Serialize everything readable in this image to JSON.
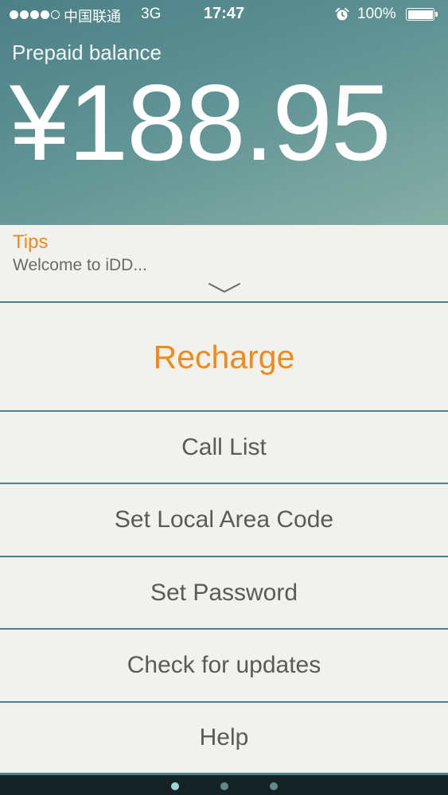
{
  "status_bar": {
    "carrier": "中国联通",
    "network": "3G",
    "time": "17:47",
    "battery": "100%",
    "signal_bars": 4,
    "signal_max": 5,
    "icons": [
      "signal-dots-icon",
      "alarm-clock-icon",
      "battery-icon"
    ]
  },
  "balance": {
    "label": "Prepaid balance",
    "amount": "¥188.95"
  },
  "tips": {
    "title": "Tips",
    "text": "Welcome to iDD...",
    "expand_icon": "chevron-down-icon"
  },
  "menu": {
    "recharge": "Recharge",
    "call_list": "Call List",
    "set_local_area_code": "Set Local Area Code",
    "set_password": "Set Password",
    "check_for_updates": "Check for updates",
    "help": "Help"
  },
  "pager": {
    "pages": 3,
    "current": 1
  },
  "colors": {
    "accent": "#f08a1a",
    "header_start": "#4d8086",
    "header_end": "#86aea5",
    "divider": "#4f8184",
    "background": "#f1f1ed",
    "menu_text": "#5a5a5a"
  }
}
